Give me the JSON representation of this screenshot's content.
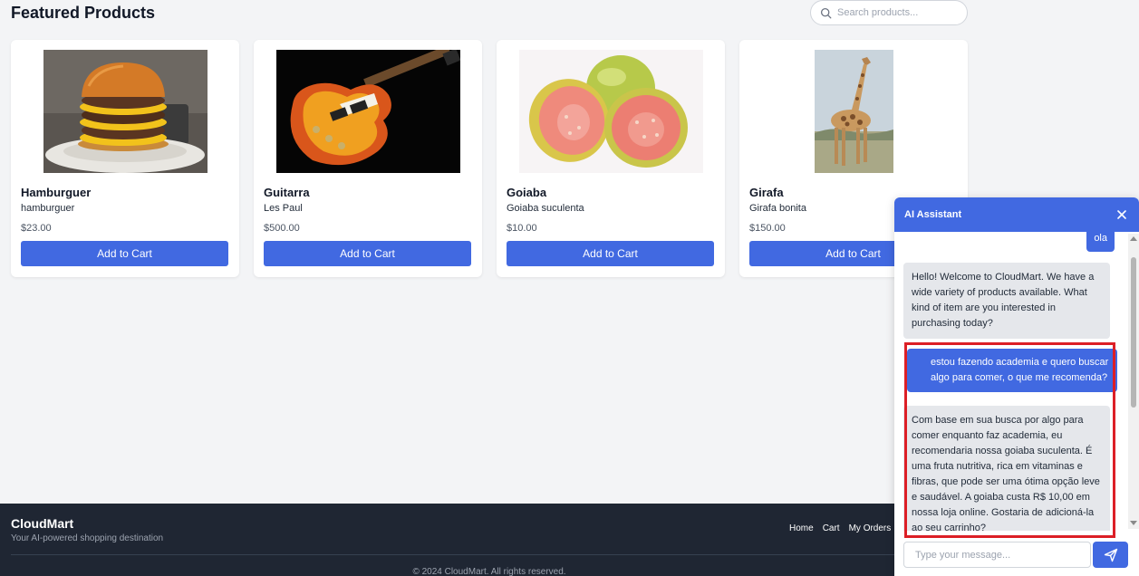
{
  "page": {
    "title": "Featured Products"
  },
  "search": {
    "placeholder": "Search products..."
  },
  "products": [
    {
      "name": "Hamburguer",
      "description": "hamburguer",
      "price": "$23.00",
      "button": "Add to Cart"
    },
    {
      "name": "Guitarra",
      "description": "Les Paul",
      "price": "$500.00",
      "button": "Add to Cart"
    },
    {
      "name": "Goiaba",
      "description": "Goiaba suculenta",
      "price": "$10.00",
      "button": "Add to Cart"
    },
    {
      "name": "Girafa",
      "description": "Girafa bonita",
      "price": "$150.00",
      "button": "Add to Cart"
    }
  ],
  "footer": {
    "brand": "CloudMart",
    "tagline": "Your AI-powered shopping destination",
    "links": [
      "Home",
      "Cart",
      "My Orders"
    ],
    "copyright": "© 2024 CloudMart. All rights reserved."
  },
  "chat": {
    "title": "AI Assistant",
    "messages": [
      {
        "role": "user",
        "text": "ola"
      },
      {
        "role": "assistant",
        "text": "Hello! Welcome to CloudMart. We have a wide variety of products available. What kind of item are you interested in purchasing today?"
      },
      {
        "role": "user",
        "text": "estou fazendo academia e quero buscar algo para comer, o que me recomenda?"
      },
      {
        "role": "assistant",
        "text": "Com base em sua busca por algo para comer enquanto faz academia, eu recomendaria nossa goiaba suculenta. É uma fruta nutritiva, rica em vitaminas e fibras, que pode ser uma ótima opção leve e saudável. A goiaba custa R$ 10,00 em nossa loja online. Gostaria de adicioná-la ao seu carrinho?"
      }
    ],
    "input_placeholder": "Type your message..."
  },
  "colors": {
    "accent": "#4169e1",
    "footer_bg": "#1f2633",
    "highlight": "#dc1f26"
  },
  "icons": {
    "search": "search-icon",
    "close": "close-icon",
    "send": "send-icon"
  }
}
